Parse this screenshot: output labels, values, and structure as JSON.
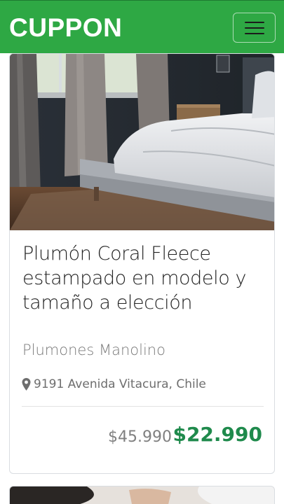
{
  "header": {
    "brand": "CUPPON",
    "menu_icon": "hamburger-icon",
    "bg_color": "#2ea844"
  },
  "offer": {
    "image": "bedroom-bed-photo",
    "title": "Plumón Coral Fleece estampado en modelo y tamaño a elección",
    "merchant": "Plumones Manolino",
    "location_icon": "map-marker-icon",
    "location": "9191 Avenida Vitacura, Chile",
    "original_price": "$45.990",
    "discount_price": "$22.990",
    "price_color": "#1f8a4c"
  }
}
